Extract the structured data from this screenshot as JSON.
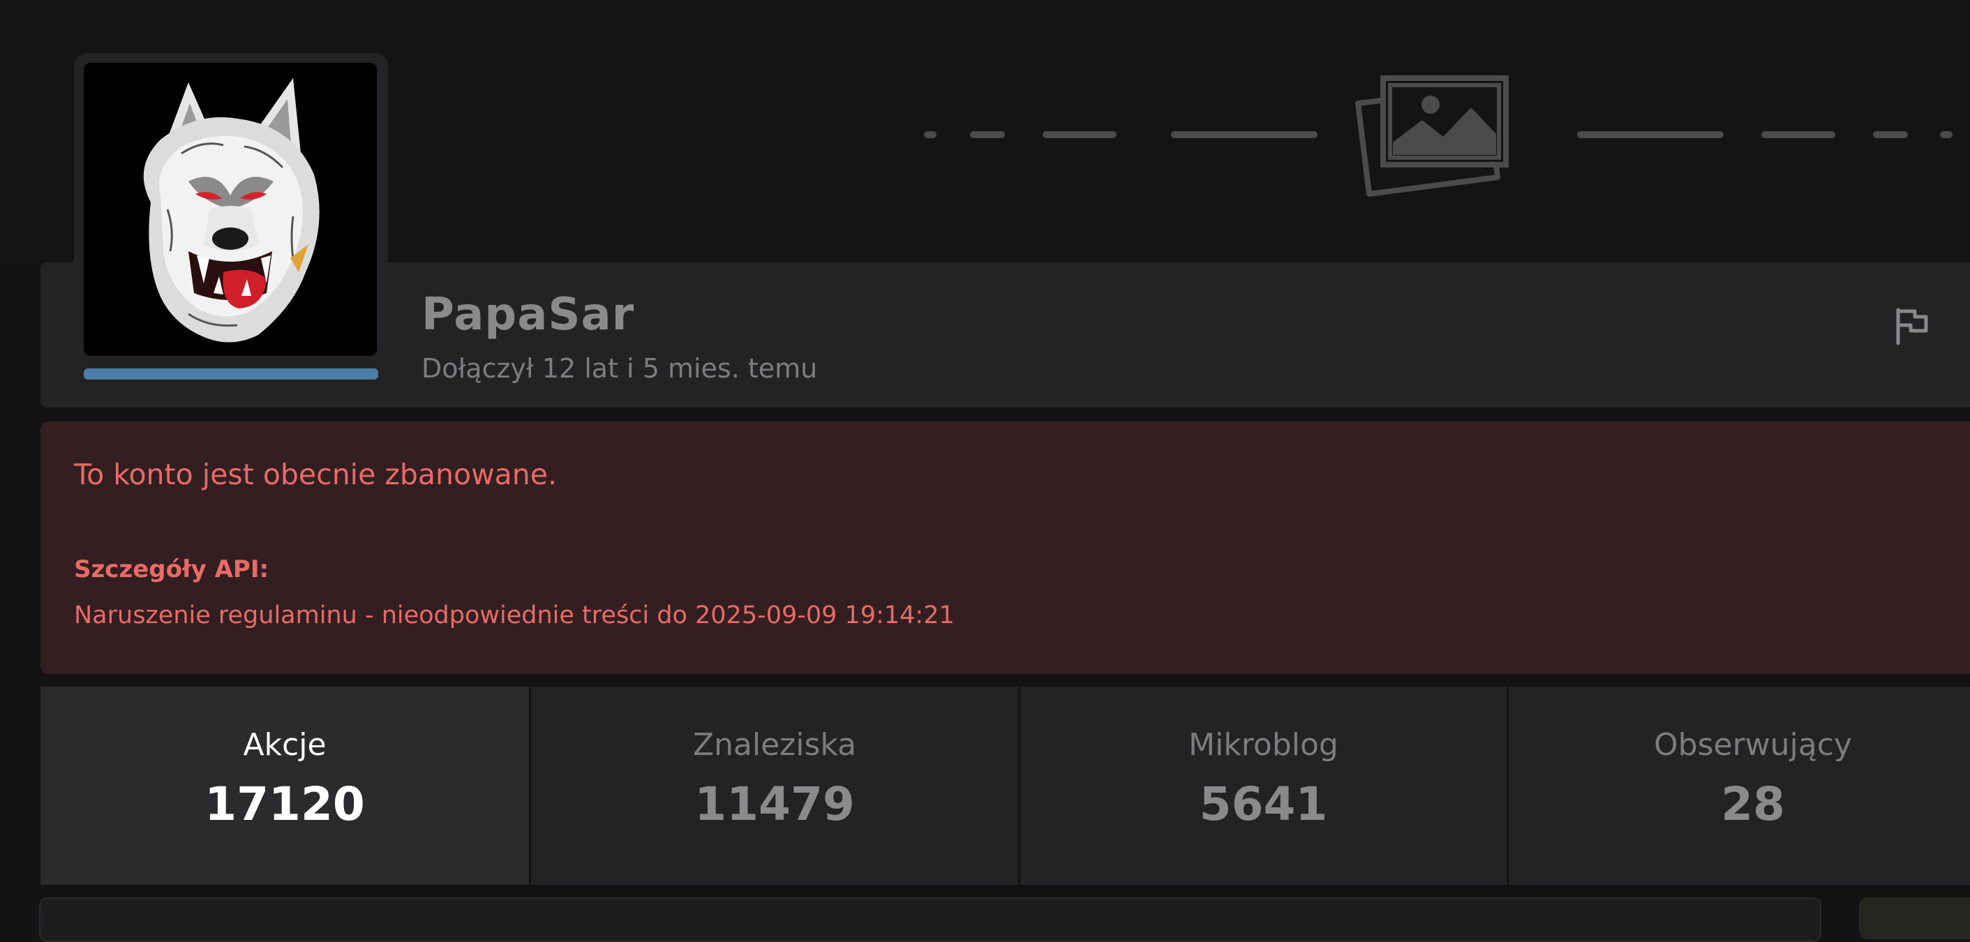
{
  "profile": {
    "username": "PapaSar",
    "joined": "Dołączył 12 lat i 5 mies. temu"
  },
  "ban": {
    "title": "To konto jest obecnie zbanowane.",
    "api_label": "Szczegóły API:",
    "reason": "Naruszenie regulaminu - nieodpowiednie treści do 2025-09-09 19:14:21"
  },
  "stats": [
    {
      "label": "Akcje",
      "value": "17120",
      "active": true
    },
    {
      "label": "Znaleziska",
      "value": "11479",
      "active": false
    },
    {
      "label": "Mikroblog",
      "value": "5641",
      "active": false
    },
    {
      "label": "Obserwujący",
      "value": "28",
      "active": false
    }
  ],
  "icons": {
    "cover": "image-placeholder-icon",
    "report": "flag-icon"
  },
  "colors": {
    "background": "#131315",
    "panel": "#232326",
    "ban_background": "#331f21",
    "ban_text": "#e86b66",
    "avatar_accent": "#4a7ea7"
  }
}
